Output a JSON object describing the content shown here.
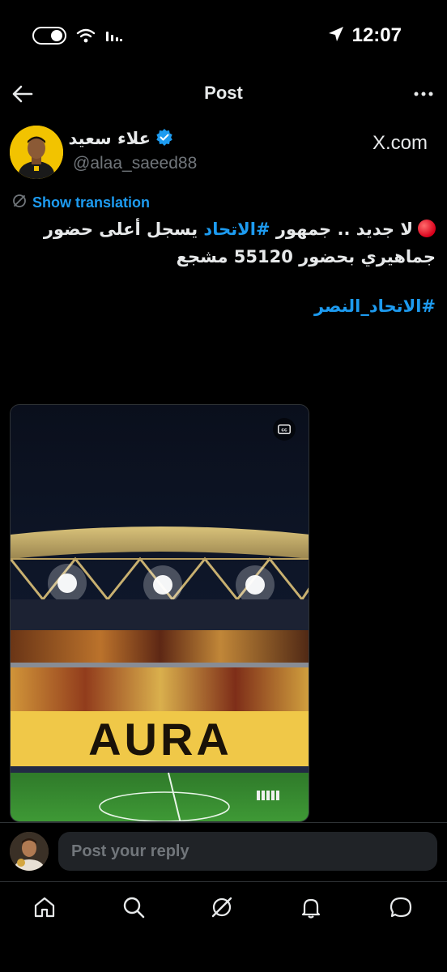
{
  "status_bar": {
    "time": "12:07",
    "icons": [
      "toggle-icon",
      "wifi-icon",
      "signal-icon",
      "location-arrow-icon"
    ]
  },
  "header": {
    "title": "Post",
    "back_icon": "arrow-left-icon",
    "more_icon": "more-horizontal-icon"
  },
  "author": {
    "name": "علاء سعيد",
    "handle": "@alaa_saeed88",
    "verified": true,
    "source": "X.com"
  },
  "translation": {
    "label": "Show translation",
    "icon": "translate-icon"
  },
  "post": {
    "line1_prefix": "لا جديد .. جمهور ",
    "line1_hashtag": "#الاتحاد",
    "line1_suffix": " يسجل أعلى حضور",
    "line2": "جماهيري بحضور 55120 مشجع",
    "hashtag_line": "#الاتحاد_النصر"
  },
  "media": {
    "type": "video",
    "cc_icon": "closed-captions-icon",
    "banner_text": "AURA"
  },
  "reply": {
    "placeholder": "Post your reply"
  },
  "bottom_nav": {
    "items": [
      "home-icon",
      "search-icon",
      "grok-icon",
      "notifications-icon",
      "messages-icon"
    ]
  },
  "colors": {
    "accent": "#1d9bf0",
    "background": "#000000",
    "text": "#e7e9ea",
    "muted": "#71767b",
    "input_bg": "#202327"
  }
}
